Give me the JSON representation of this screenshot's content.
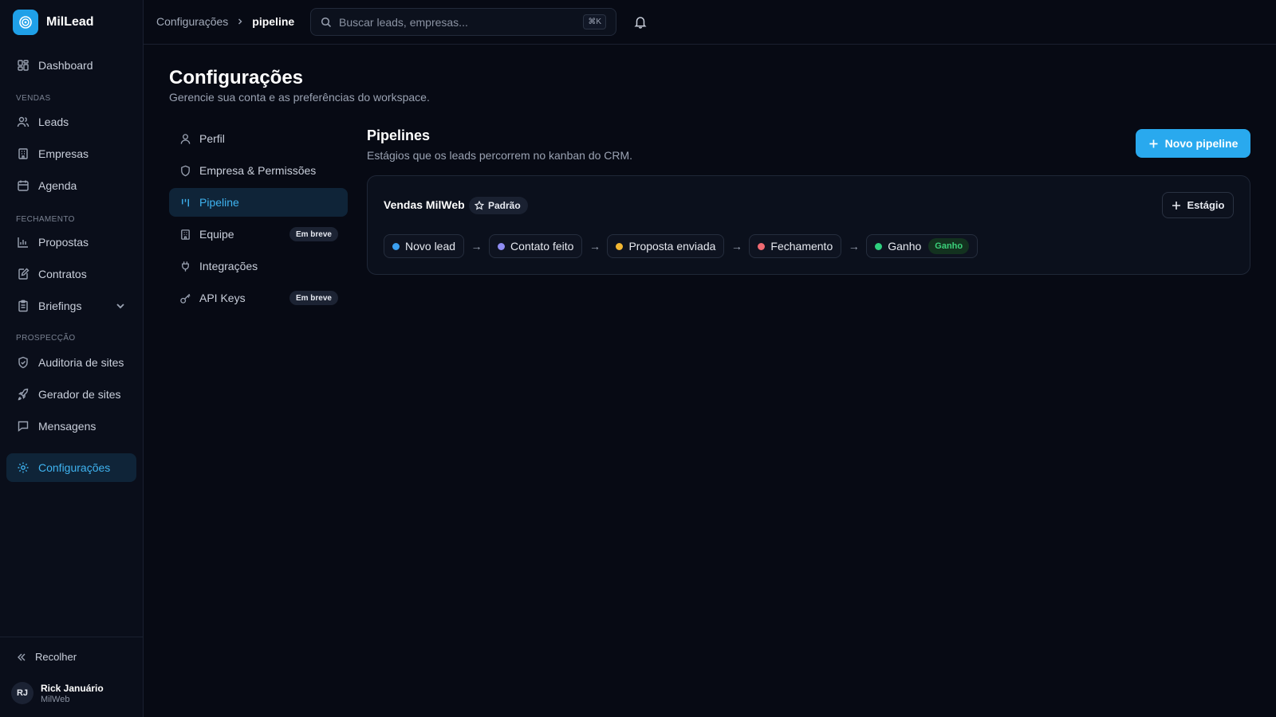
{
  "app": {
    "name": "MilLead",
    "accent": "#29a9ee"
  },
  "sidebar": {
    "dashboard": "Dashboard",
    "sections": {
      "vendas": "VENDAS",
      "fechamento": "FECHAMENTO",
      "prospeccao": "PROSPECÇÃO"
    },
    "items": {
      "leads": "Leads",
      "empresas": "Empresas",
      "agenda": "Agenda",
      "propostas": "Propostas",
      "contratos": "Contratos",
      "briefings": "Briefings",
      "auditoria": "Auditoria de sites",
      "gerador": "Gerador de sites",
      "mensagens": "Mensagens",
      "configuracoes": "Configurações"
    },
    "collapse_label": "Recolher",
    "user": {
      "initials": "RJ",
      "name": "Rick Januário",
      "org": "MilWeb"
    }
  },
  "topbar": {
    "breadcrumb": [
      "Configurações",
      "pipeline"
    ],
    "search_placeholder": "Buscar leads, empresas...",
    "search_shortcut": "⌘K"
  },
  "page": {
    "title": "Configurações",
    "subtitle": "Gerencie sua conta e as preferências do workspace."
  },
  "settings_nav": {
    "perfil": "Perfil",
    "empresa": "Empresa & Permissões",
    "pipeline": "Pipeline",
    "equipe": "Equipe",
    "integracoes": "Integrações",
    "api_keys": "API Keys",
    "soon_badge": "Em breve"
  },
  "pipelines": {
    "title": "Pipelines",
    "subtitle": "Estágios que os leads percorrem no kanban do CRM.",
    "new_button": "Novo pipeline",
    "card": {
      "name": "Vendas MilWeb",
      "default_badge": "Padrão",
      "add_stage_button": "Estágio",
      "stages": [
        {
          "label": "Novo lead",
          "color": "#3b9ff0"
        },
        {
          "label": "Contato feito",
          "color": "#8f8cf2"
        },
        {
          "label": "Proposta enviada",
          "color": "#f2b632"
        },
        {
          "label": "Fechamento",
          "color": "#f06a72"
        },
        {
          "label": "Ganho",
          "color": "#2ecf7e",
          "badge": "Ganho"
        }
      ]
    }
  }
}
